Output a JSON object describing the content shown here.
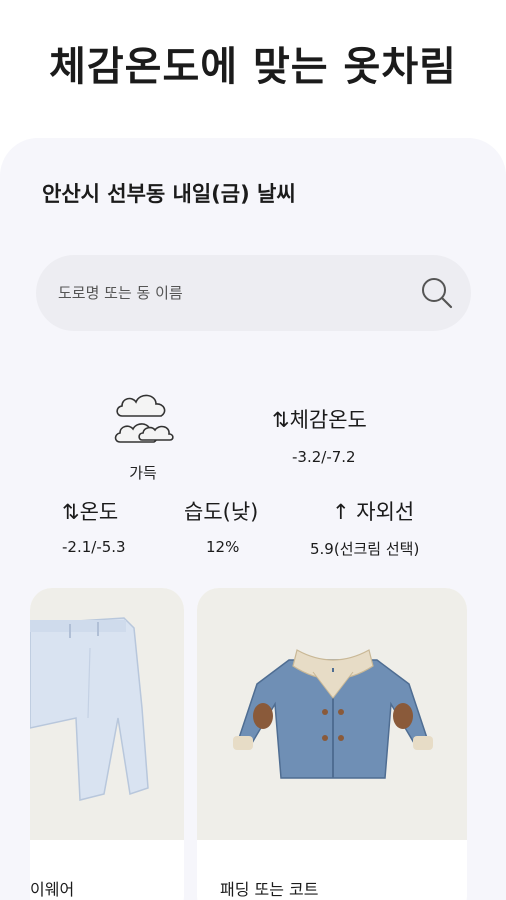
{
  "header": {
    "title": "체감온도에 맞는 옷차림"
  },
  "location": {
    "title": "안산시 선부동 내일(금) 날씨"
  },
  "search": {
    "placeholder": "도로명 또는 동 이름"
  },
  "weather": {
    "sky": {
      "icon": "cloud-icon",
      "label": "가득"
    },
    "feels_like": {
      "label": "⇅체감온도",
      "value": "-3.2/-7.2"
    },
    "temperature": {
      "label": "⇅온도",
      "value": "-2.1/-5.3"
    },
    "humidity": {
      "label": "습도(낮)",
      "value": "12%"
    },
    "uv": {
      "label": "↑ 자외선",
      "value": "5.9(선크림 선택)"
    }
  },
  "clothes": [
    {
      "name": "이웨어",
      "image": "light-blue-pants-image"
    },
    {
      "name": "패딩 또는 코트",
      "image": "denim-shearling-jacket-image"
    }
  ],
  "colors": {
    "background": "#ffffff",
    "card": "#f6f6fb",
    "search": "#ededf2",
    "image_bg": "#efeee9"
  }
}
